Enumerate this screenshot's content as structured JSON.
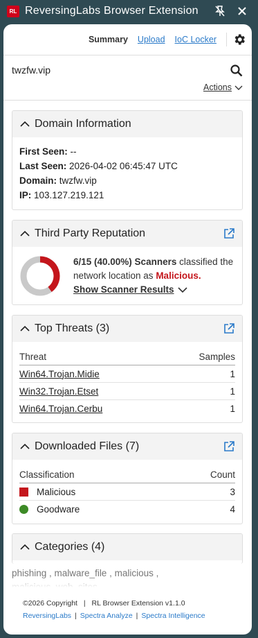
{
  "window": {
    "logo_text": "RL",
    "title": "ReversingLabs Browser Extension"
  },
  "nav": {
    "summary": "Summary",
    "upload": "Upload",
    "ioc_locker": "IoC Locker"
  },
  "search": {
    "value": "twzfw.vip",
    "actions_label": "Actions"
  },
  "domain_info": {
    "title": "Domain Information",
    "first_seen_label": "First Seen:",
    "first_seen_value": "--",
    "last_seen_label": "Last Seen:",
    "last_seen_value": "2026-04-02 06:45:47 UTC",
    "domain_label": "Domain:",
    "domain_value": "twzfw.vip",
    "ip_label": "IP:",
    "ip_value": "103.127.219.121"
  },
  "reputation": {
    "title": "Third Party Reputation",
    "stat": "6/15 (40.00%) Scanners",
    "text_mid": " classified the network location as ",
    "verdict": "Malicious.",
    "show_results": "Show Scanner Results",
    "malicious_fraction": 0.4,
    "colors": {
      "malicious": "#c4161c",
      "rest": "#c9c9c9"
    }
  },
  "top_threats": {
    "title": "Top Threats (3)",
    "col_threat": "Threat",
    "col_samples": "Samples",
    "rows": [
      {
        "name": "Win64.Trojan.Midie",
        "samples": "1"
      },
      {
        "name": "Win32.Trojan.Etset",
        "samples": "1"
      },
      {
        "name": "Win64.Trojan.Cerbu",
        "samples": "1"
      }
    ]
  },
  "downloaded": {
    "title": "Downloaded Files (7)",
    "col_class": "Classification",
    "col_count": "Count",
    "rows": [
      {
        "label": "Malicious",
        "count": "3"
      },
      {
        "label": "Goodware",
        "count": "4"
      }
    ]
  },
  "categories": {
    "title": "Categories (4)",
    "text": "phishing , malware_file , malicious , malicious_web_sites"
  },
  "footer": {
    "copyright": "©2026 Copyright",
    "version": "RL Browser Extension v1.1.0",
    "link1": "ReversingLabs",
    "link2": "Spectra Analyze",
    "link3": "Spectra Intelligence"
  }
}
